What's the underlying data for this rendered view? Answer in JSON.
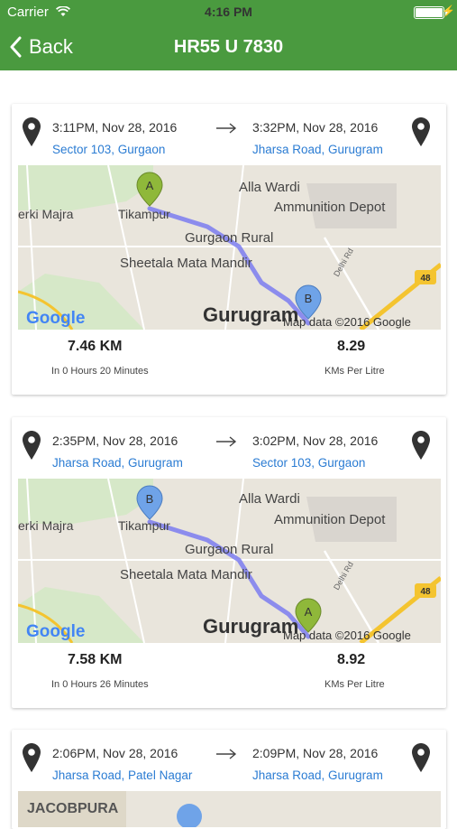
{
  "status": {
    "carrier": "Carrier",
    "time": "4:16 PM"
  },
  "nav": {
    "back": "Back",
    "title": "HR55 U 7830"
  },
  "map_labels": {
    "alla_wardi": "Alla Wardi",
    "ammunition": "Ammunition Depot",
    "berki": "erki Majra",
    "tikampur": "Tikampur",
    "gurgaon_rural": "Gurgaon Rural",
    "sheetala": "Sheetala Mata Mandir",
    "gurugram": "Gurugram",
    "map_data": "Map data ©2016 Google",
    "delhi_rd": "Delhi Rd",
    "route48": "48",
    "google": "Google",
    "jacobpura": "JACOBPURA"
  },
  "trips": [
    {
      "start_time": "3:11PM, Nov 28, 2016",
      "start_place": "Sector 103, Gurgaon",
      "end_time": "3:32PM, Nov 28, 2016",
      "end_place": "Jharsa Road, Gurugram",
      "distance": "7.46 KM",
      "duration": "In 0 Hours 20 Minutes",
      "mileage": "8.29",
      "mileage_label": "KMs Per Litre",
      "marker_a": "A",
      "marker_b": "B"
    },
    {
      "start_time": "2:35PM, Nov 28, 2016",
      "start_place": "Jharsa Road, Gurugram",
      "end_time": "3:02PM, Nov 28, 2016",
      "end_place": "Sector 103, Gurgaon",
      "distance": "7.58 KM",
      "duration": "In 0 Hours 26 Minutes",
      "mileage": "8.92",
      "mileage_label": "KMs Per Litre",
      "marker_a": "A",
      "marker_b": "B"
    },
    {
      "start_time": "2:06PM, Nov 28, 2016",
      "start_place": "Jharsa Road, Patel Nagar",
      "end_time": "2:09PM, Nov 28, 2016",
      "end_place": "Jharsa Road, Gurugram"
    }
  ],
  "colors": {
    "nav": "#4a9a3f",
    "link": "#2b7cd3",
    "route": "#7b7cf0",
    "marker_a": "#8fb83a",
    "marker_b": "#6fa3e8"
  }
}
